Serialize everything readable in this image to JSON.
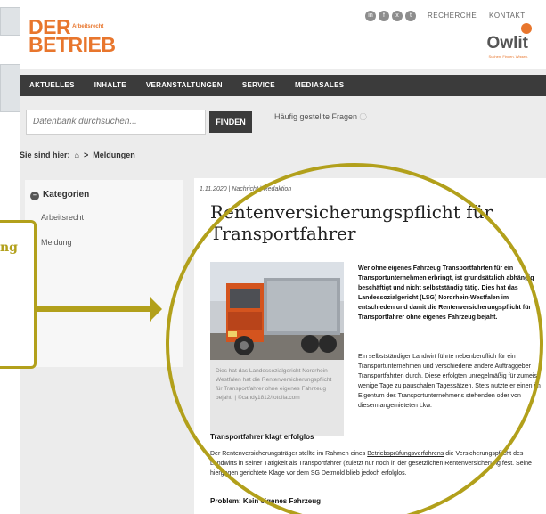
{
  "header": {
    "logo_main": "DER",
    "logo_sub": "Arbeitsrecht",
    "logo_second": "BETRIEB",
    "social_icons": [
      "linkedin-icon",
      "facebook-icon",
      "xing-icon",
      "twitter-icon"
    ],
    "links": [
      "RECHERCHE",
      "KONTAKT"
    ],
    "partner_logo": "Owlit",
    "partner_tagline": "Suchen. Finden. Wissen."
  },
  "nav": [
    "AKTUELLES",
    "INHALTE",
    "VERANSTALTUNGEN",
    "SERVICE",
    "MEDIASALES"
  ],
  "search": {
    "placeholder": "Datenbank durchsuchen...",
    "button": "FINDEN",
    "faq": "Häufig gestellte Fragen"
  },
  "breadcrumb": {
    "prefix": "Sie sind hier:",
    "sep": ">",
    "current": "Meldungen"
  },
  "sidebar": {
    "heading": "Kategorien",
    "items": [
      "Arbeitsrecht",
      "Meldung"
    ]
  },
  "article": {
    "meta": "1.11.2020 | Nachricht | Redaktion",
    "title": "Rentenversicherungspflicht für Transportfahrer",
    "lead": "Wer ohne eigenes Fahrzeug Transportfahrten für ein Transportunternehmen erbringt, ist grundsätzlich abhängig beschäftigt und nicht selbstständig tätig. Dies hat das Landessozialgericht (LSG) Nordrhein-Westfalen im entschieden und damit die Rentenversicherungspflicht für Transportfahrer ohne eigenes Fahrzeug bejaht.",
    "body1": "Ein selbstständiger Landwirt führte nebenberuflich für ein Transportunternehmen und verschiedene andere Auftraggeber Transportfahrten durch. Diese erfolgten unregelmäßig für zumeist wenige Tage zu pauschalen Tagessätzen. Stets nutzte er einen im Eigentum des Transportunternehmens stehenden oder von diesem angemieteten Lkw.",
    "caption": "Dies hat das Landessozialgericht Nordrhein-Westfalen hat die Rentenversicherungspflicht für Transportfahrer ohne eigenes Fahrzeug bejaht. | ©candy1812/fotolia.com",
    "subhead1": "Transportfahrer klagt erfolglos",
    "body2_pre": "Der Rentenversicherungsträger stellte im Rahmen eines ",
    "body2_link": "Betriebsprüfungsverfahrens",
    "body2_post": " die Versicherungspflicht des Landwirts in seiner Tätigkeit als Transportfahrer (zuletzt nur noch in der gesetzlichen Rentenversicherung fest. Seine hiergegen gerichtete Klage vor dem SG Detmold blieb jedoch erfolglos.",
    "subhead2": "Problem: Kein eigenes Fahrzeug"
  },
  "callout": {
    "text": "ng"
  },
  "colors": {
    "accent_orange": "#e8762d",
    "annotation_gold": "#b2a01b",
    "nav_bg": "#3b3b3b"
  }
}
